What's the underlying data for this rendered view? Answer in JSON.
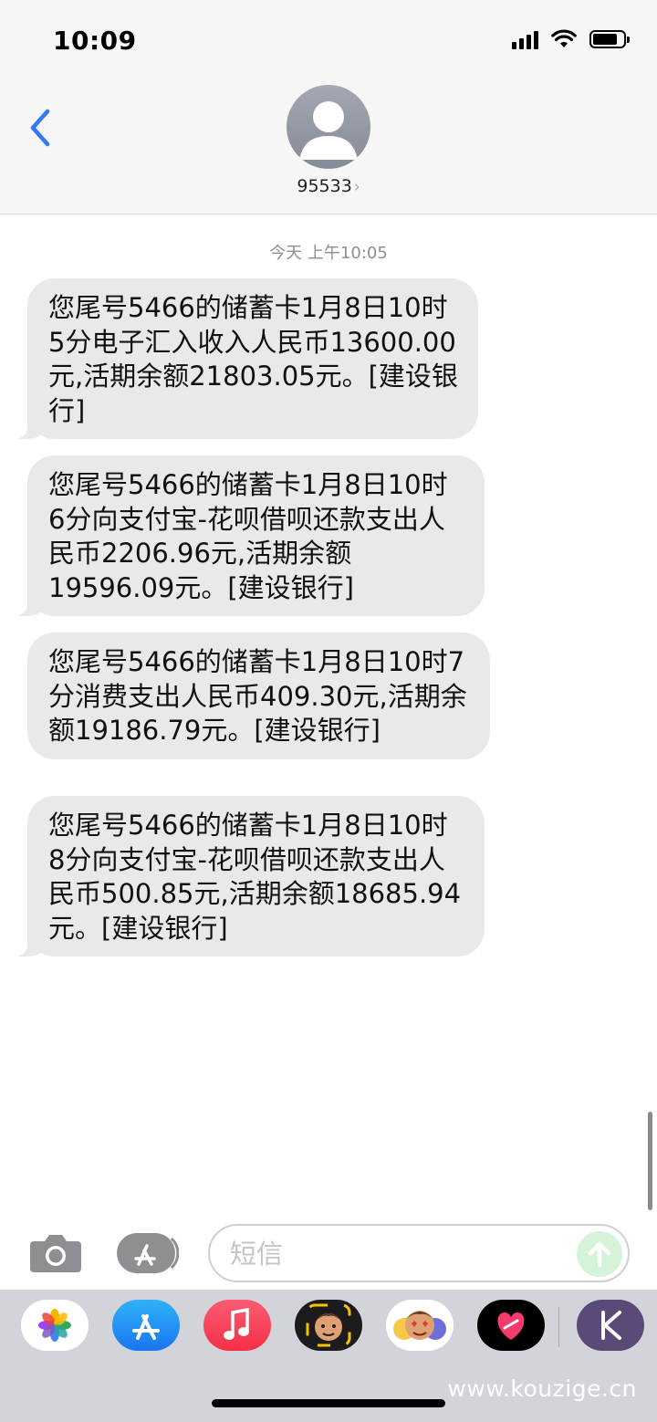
{
  "status_bar": {
    "time": "10:09"
  },
  "header": {
    "contact_name": "95533",
    "chevron": "›"
  },
  "conversation": {
    "timestamp": "今天 上午10:05",
    "messages": [
      {
        "text": "您尾号5466的储蓄卡1月8日10时5分电子汇入收入人民币13600.00元,活期余额21803.05元。[建设银行]"
      },
      {
        "text": "您尾号5466的储蓄卡1月8日10时6分向支付宝-花呗借呗还款支出人民币2206.96元,活期余额19596.09元。[建设银行]"
      },
      {
        "text": "您尾号5466的储蓄卡1月8日10时7分消费支出人民币409.30元,活期余额19186.79元。[建设银行]"
      },
      {
        "text": "您尾号5466的储蓄卡1月8日10时8分向支付宝-花呗借呗还款支出人民币500.85元,活期余额18685.94元。[建设银行]"
      }
    ]
  },
  "input_bar": {
    "placeholder": "短信"
  },
  "app_drawer": {
    "apps": [
      "photos-icon",
      "app-store-icon",
      "music-icon",
      "memoji-icon",
      "memoji-stickers-icon",
      "digital-touch-icon",
      "k-app-icon"
    ]
  },
  "watermark": "www.kouzige.cn",
  "colors": {
    "accent": "#3478f6",
    "bubble": "#e9e9eb",
    "header_bg": "#f6f6f6",
    "drawer_bg": "#d3d4d9"
  }
}
